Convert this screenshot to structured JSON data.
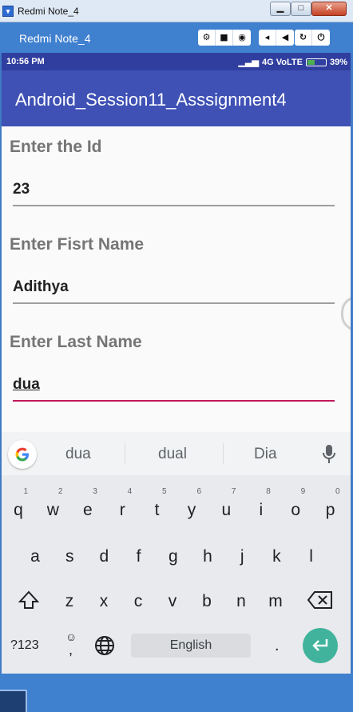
{
  "window": {
    "title": "Redmi Note_4",
    "minimize": "▁",
    "maximize": "□",
    "close": "✕"
  },
  "emulator": {
    "title": "Redmi Note_4",
    "icons": [
      "gear-icon",
      "camera-icon",
      "screenshot-icon",
      "volume-down-icon",
      "volume-up-icon",
      "rotate-icon",
      "power-icon"
    ]
  },
  "status_bar": {
    "time": "10:56 PM",
    "network": "4G VoLTE",
    "battery": "39%",
    "battery_level": 0.39
  },
  "app_bar": {
    "title": "Android_Session11_Asssignment4"
  },
  "form": {
    "id_label": "Enter the Id",
    "id_value": "23",
    "first_label": "Enter Fisrt Name",
    "first_value": "Adithya",
    "last_label": "Enter Last Name",
    "last_value": "dua"
  },
  "keyboard": {
    "suggestions": [
      "dua",
      "dual",
      "Dia"
    ],
    "row1": [
      "q",
      "w",
      "e",
      "r",
      "t",
      "y",
      "u",
      "i",
      "o",
      "p"
    ],
    "row1_hints": [
      "1",
      "2",
      "3",
      "4",
      "5",
      "6",
      "7",
      "8",
      "9",
      "0"
    ],
    "row2": [
      "a",
      "s",
      "d",
      "f",
      "g",
      "h",
      "j",
      "k",
      "l"
    ],
    "row3": [
      "z",
      "x",
      "c",
      "v",
      "b",
      "n",
      "m"
    ],
    "symbols": "?123",
    "emoji_comma": ",",
    "space": "English",
    "period": "."
  },
  "colors": {
    "primary": "#3f51b5",
    "primary_dark": "#303f9f",
    "accent": "#c2185b",
    "enter_key": "#41b39c"
  }
}
